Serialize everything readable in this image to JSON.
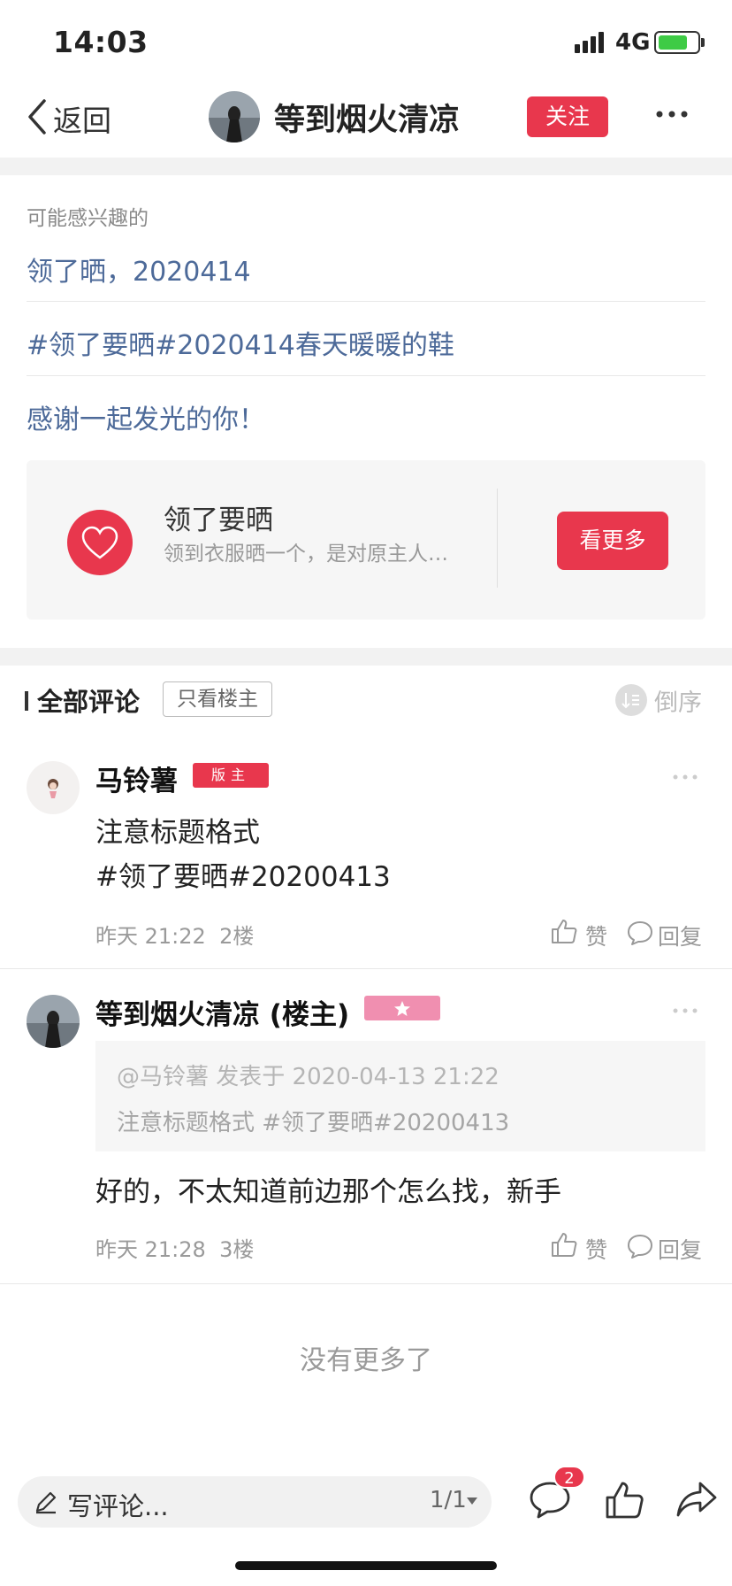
{
  "status_bar": {
    "time": "14:03",
    "network": "4G"
  },
  "header": {
    "back_label": "返回",
    "user_name": "等到烟火清凉",
    "follow_label": "关注"
  },
  "related": {
    "section_label": "可能感兴趣的",
    "links": [
      "领了晒，2020414",
      "#领了要晒#2020414春天暖暖的鞋",
      "感谢一起发光的你！"
    ]
  },
  "topic_card": {
    "title": "领了要晒",
    "description": "领到衣服晒一个，是对原主人…",
    "button_label": "看更多"
  },
  "comments_header": {
    "title": "全部评论",
    "op_only_label": "只看楼主",
    "sort_label": "倒序"
  },
  "comments": [
    {
      "author": "马铃薯",
      "badge": "版主",
      "body": [
        "注意标题格式",
        "#领了要晒#20200413"
      ],
      "time": "昨天 21:22",
      "floor": "2楼",
      "like_label": "赞",
      "reply_label": "回复"
    },
    {
      "author": "等到烟火清凉 (楼主)",
      "badge_icon": "star-icon",
      "quote": {
        "header": "@马铃薯 发表于 2020-04-13 21:22",
        "text": "注意标题格式 #领了要晒#20200413"
      },
      "body": [
        "好的，不太知道前边那个怎么找，新手"
      ],
      "time": "昨天 21:28",
      "floor": "3楼",
      "like_label": "赞",
      "reply_label": "回复"
    }
  ],
  "footer_note": "没有更多了",
  "bottom_bar": {
    "input_placeholder": "写评论...",
    "page_indicator": "1/1",
    "comment_count": "2"
  },
  "colors": {
    "accent": "#e8374d",
    "link": "#4d6a99",
    "star_badge": "#f08fb0"
  }
}
